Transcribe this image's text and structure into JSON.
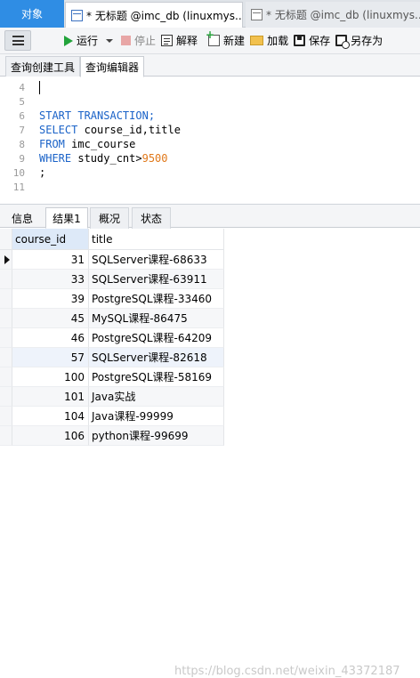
{
  "doc_tabs": {
    "objects": "对象",
    "active": "* 无标题 @imc_db (linuxmys...",
    "inactive": "* 无标题 @imc_db (linuxmys..."
  },
  "toolbar": {
    "run": "运行",
    "stop": "停止",
    "explain": "解释",
    "new": "新建",
    "load": "加载",
    "save": "保存",
    "save_as": "另存为"
  },
  "sub_tabs": [
    "查询创建工具",
    "查询编辑器"
  ],
  "editor": {
    "lines": [
      {
        "n": "4",
        "text": ""
      },
      {
        "n": "5",
        "text": ""
      },
      {
        "n": "6",
        "text": "START TRANSACTION;"
      },
      {
        "n": "7",
        "text": "SELECT course_id,title"
      },
      {
        "n": "8",
        "text": "FROM imc_course"
      },
      {
        "n": "9",
        "text": "WHERE study_cnt>9500"
      },
      {
        "n": "10",
        "text": ";"
      },
      {
        "n": "11",
        "text": ""
      }
    ]
  },
  "result_tabs": [
    "信息",
    "结果1",
    "概况",
    "状态"
  ],
  "grid": {
    "columns": [
      "course_id",
      "title"
    ],
    "rows": [
      [
        "31",
        "SQLServer课程-68633"
      ],
      [
        "33",
        "SQLServer课程-63911"
      ],
      [
        "39",
        "PostgreSQL课程-33460"
      ],
      [
        "45",
        "MySQL课程-86475"
      ],
      [
        "46",
        "PostgreSQL课程-64209"
      ],
      [
        "57",
        "SQLServer课程-82618"
      ],
      [
        "100",
        "PostgreSQL课程-58169"
      ],
      [
        "101",
        "Java实战"
      ],
      [
        "104",
        "Java课程-99999"
      ],
      [
        "106",
        "python课程-99699"
      ]
    ]
  },
  "watermark": "https://blog.csdn.net/weixin_43372187"
}
